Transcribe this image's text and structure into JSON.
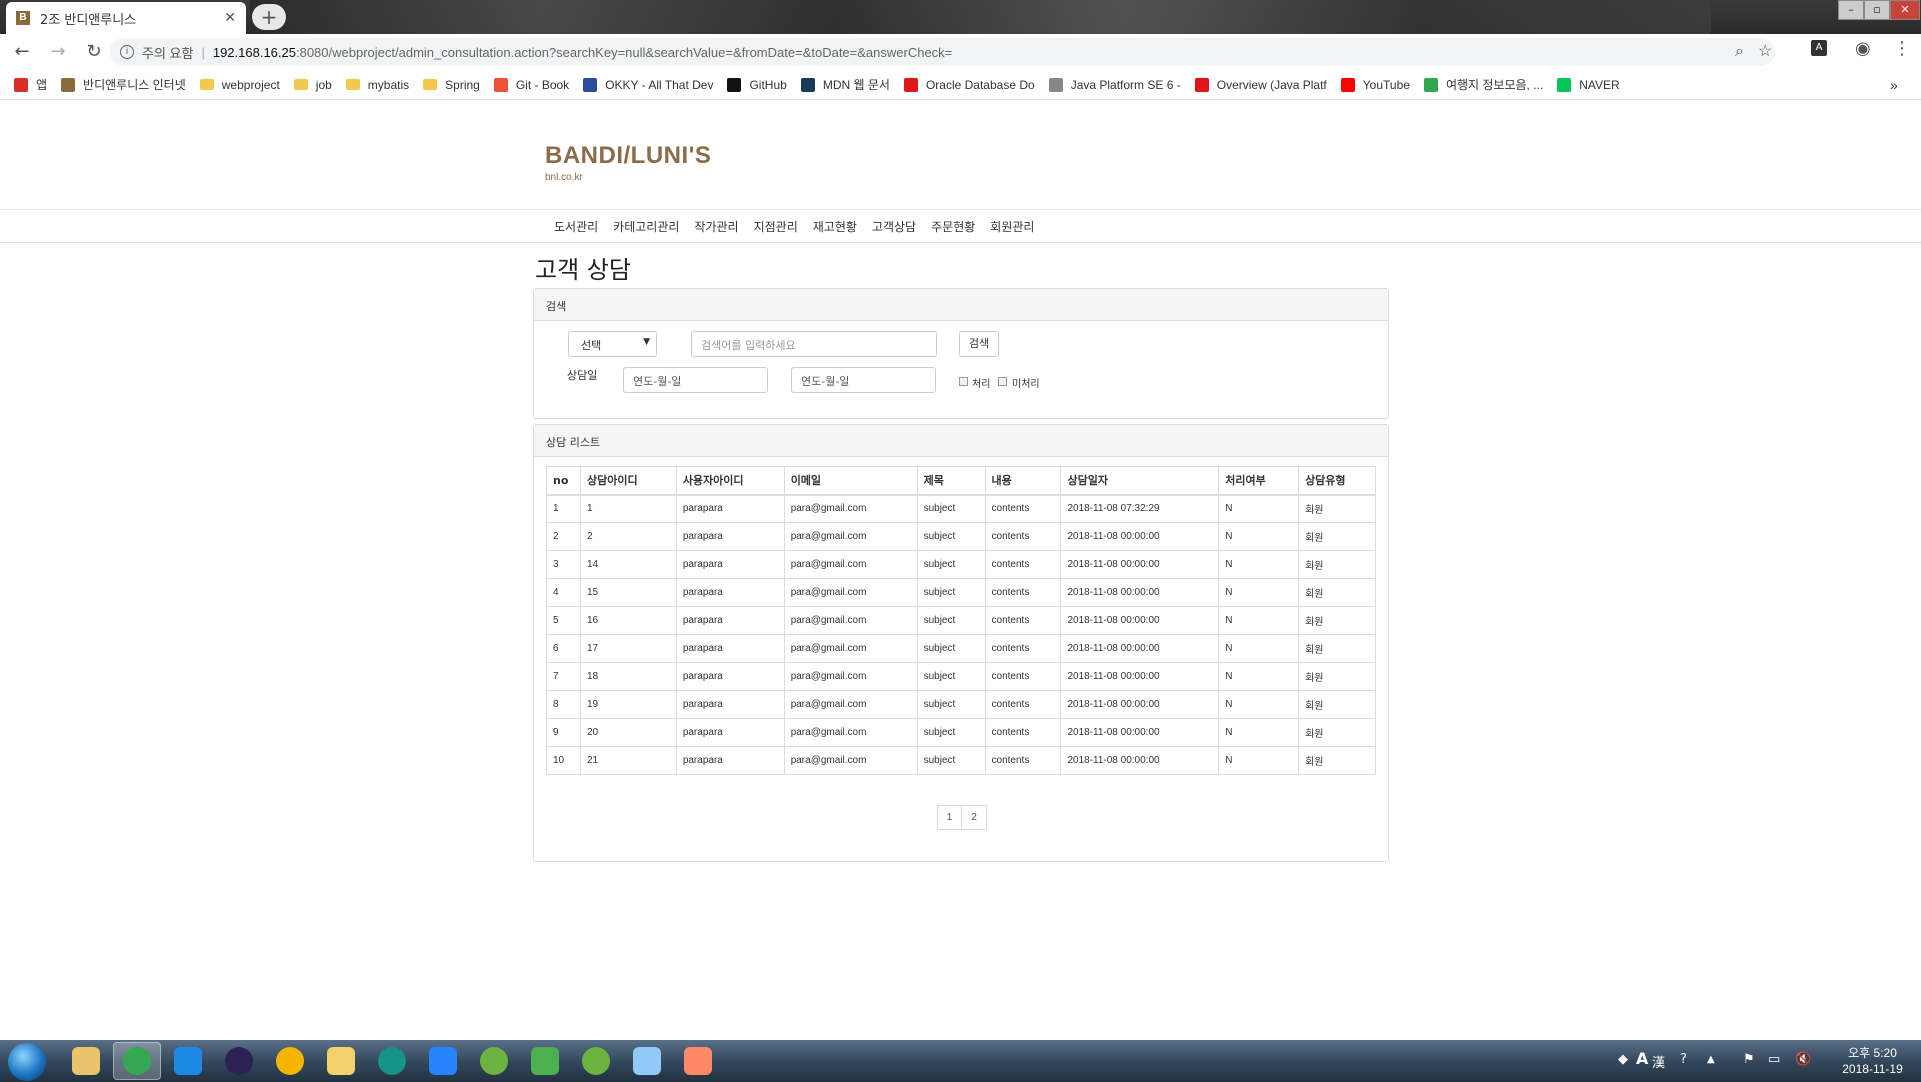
{
  "browser": {
    "tab_title": "2조 반디앤루니스",
    "tab_favicon": "B",
    "tab_close": "✕",
    "new_tab": "+",
    "address": {
      "security_text": "주의 요함",
      "host": "192.168.16.25",
      "rest": ":8080/webproject/admin_consultation.action?searchKey=null&searchValue=&fromDate=&toDate=&answerCheck="
    },
    "bookmarks": [
      {
        "label": "앱",
        "icon": "apps-grid-icon",
        "color": "#d93025"
      },
      {
        "label": "반디앤루니스 인터넷",
        "icon": "bandi-favicon",
        "color": "#8b6b3a"
      },
      {
        "label": "webproject",
        "icon": "folder-icon",
        "color": "#f2c94c"
      },
      {
        "label": "job",
        "icon": "folder-icon",
        "color": "#f2c94c"
      },
      {
        "label": "mybatis",
        "icon": "folder-icon",
        "color": "#f2c94c"
      },
      {
        "label": "Spring",
        "icon": "folder-icon",
        "color": "#f2c94c"
      },
      {
        "label": "Git - Book",
        "icon": "git-icon",
        "color": "#f05033"
      },
      {
        "label": "OKKY - All That Dev",
        "icon": "okky-icon",
        "color": "#2b4c9b"
      },
      {
        "label": "GitHub",
        "icon": "github-icon",
        "color": "#111111"
      },
      {
        "label": "MDN 웹 문서",
        "icon": "mdn-icon",
        "color": "#1a3a5c"
      },
      {
        "label": "Oracle Database Do",
        "icon": "oracle-icon",
        "color": "#e0161b"
      },
      {
        "label": "Java Platform SE 6 -",
        "icon": "page-icon",
        "color": "#888888"
      },
      {
        "label": "Overview (Java Platf",
        "icon": "oracle-icon",
        "color": "#e0161b"
      },
      {
        "label": "YouTube",
        "icon": "youtube-icon",
        "color": "#ff0000"
      },
      {
        "label": "여행지 정보모음, ...",
        "icon": "travel-icon",
        "color": "#2fa84f"
      },
      {
        "label": "NAVER",
        "icon": "naver-icon",
        "color": "#03c75a"
      }
    ],
    "bookmarks_more": "»"
  },
  "site": {
    "logo": "BANDI/LUNI'S",
    "logo_sub": "bnl.co.kr",
    "nav": [
      "도서관리",
      "카테고리관리",
      "작가관리",
      "지점관리",
      "재고현황",
      "고객상담",
      "주문현황",
      "회원관리"
    ]
  },
  "page": {
    "title": "고객 상담",
    "search": {
      "panel_title": "검색",
      "select_value": "선택",
      "keyword_placeholder": "검색어를 입력하세요",
      "search_button": "검색",
      "date_label": "상담일",
      "from_placeholder": "연도-월-일",
      "to_placeholder": "연도-월-일",
      "check_done": "처리",
      "check_pending": "미처리"
    },
    "list": {
      "panel_title": "상담 리스트",
      "columns": [
        "no",
        "상담아이디",
        "사용자아이디",
        "이메일",
        "제목",
        "내용",
        "상담일자",
        "처리여부",
        "상담유형"
      ],
      "rows": [
        [
          "1",
          "1",
          "parapara",
          "para@gmail.com",
          "subject",
          "contents",
          "2018-11-08 07:32:29",
          "N",
          "회원"
        ],
        [
          "2",
          "2",
          "parapara",
          "para@gmail.com",
          "subject",
          "contents",
          "2018-11-08 00:00:00",
          "N",
          "회원"
        ],
        [
          "3",
          "14",
          "parapara",
          "para@gmail.com",
          "subject",
          "contents",
          "2018-11-08 00:00:00",
          "N",
          "회원"
        ],
        [
          "4",
          "15",
          "parapara",
          "para@gmail.com",
          "subject",
          "contents",
          "2018-11-08 00:00:00",
          "N",
          "회원"
        ],
        [
          "5",
          "16",
          "parapara",
          "para@gmail.com",
          "subject",
          "contents",
          "2018-11-08 00:00:00",
          "N",
          "회원"
        ],
        [
          "6",
          "17",
          "parapara",
          "para@gmail.com",
          "subject",
          "contents",
          "2018-11-08 00:00:00",
          "N",
          "회원"
        ],
        [
          "7",
          "18",
          "parapara",
          "para@gmail.com",
          "subject",
          "contents",
          "2018-11-08 00:00:00",
          "N",
          "회원"
        ],
        [
          "8",
          "19",
          "parapara",
          "para@gmail.com",
          "subject",
          "contents",
          "2018-11-08 00:00:00",
          "N",
          "회원"
        ],
        [
          "9",
          "20",
          "parapara",
          "para@gmail.com",
          "subject",
          "contents",
          "2018-11-08 00:00:00",
          "N",
          "회원"
        ],
        [
          "10",
          "21",
          "parapara",
          "para@gmail.com",
          "subject",
          "contents",
          "2018-11-08 00:00:00",
          "N",
          "회원"
        ]
      ],
      "pages": [
        "1",
        "2"
      ]
    }
  },
  "taskbar": {
    "apps": [
      {
        "name": "explorer-icon",
        "color": "#e9c46a"
      },
      {
        "name": "chrome-icon",
        "color": "#34a853",
        "active": true
      },
      {
        "name": "ie-icon",
        "color": "#1e88e5"
      },
      {
        "name": "eclipse-icon",
        "color": "#2c2255"
      },
      {
        "name": "chrome-canary-icon",
        "color": "#f4b400"
      },
      {
        "name": "folder-icon",
        "color": "#f2d16b"
      },
      {
        "name": "gitkraken-icon",
        "color": "#179287"
      },
      {
        "name": "sourcetree-icon",
        "color": "#2684ff"
      },
      {
        "name": "spring-tool-icon",
        "color": "#6db33f"
      },
      {
        "name": "media-player-icon",
        "color": "#4caf50"
      },
      {
        "name": "spring-tool-icon",
        "color": "#6db33f"
      },
      {
        "name": "notepad-icon",
        "color": "#90caf9"
      },
      {
        "name": "paint-icon",
        "color": "#ff8a65"
      }
    ],
    "ime": "A",
    "ime_hanja": "漢",
    "clock_period": "오후 5:20",
    "clock_date": "2018-11-19"
  }
}
